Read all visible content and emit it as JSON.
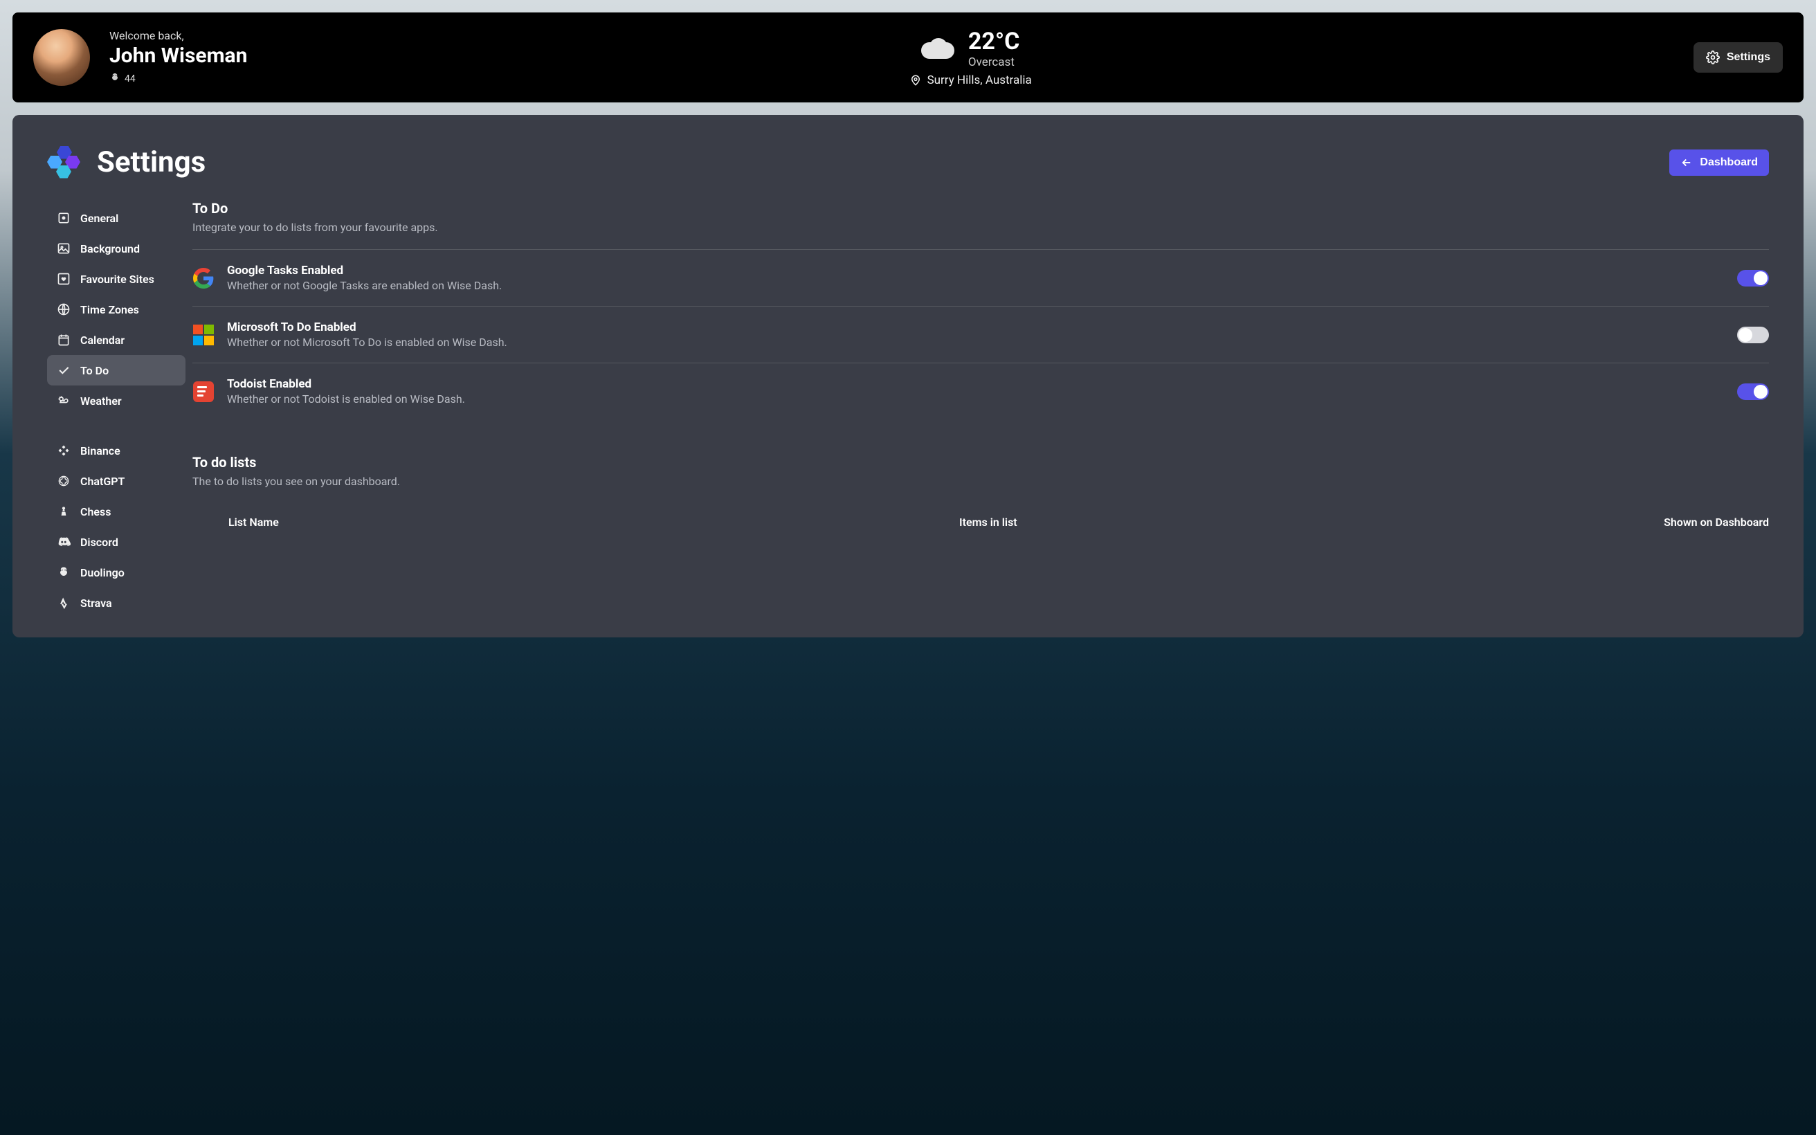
{
  "header": {
    "welcome": "Welcome back,",
    "username": "John Wiseman",
    "points": "44",
    "weather": {
      "temp": "22°C",
      "condition": "Overcast",
      "location": "Surry Hills, Australia"
    },
    "settings_button": "Settings"
  },
  "panel": {
    "title": "Settings",
    "dashboard_button": "Dashboard"
  },
  "sidebar": {
    "group1": [
      {
        "id": "general",
        "label": "General"
      },
      {
        "id": "background",
        "label": "Background"
      },
      {
        "id": "favourite-sites",
        "label": "Favourite Sites"
      },
      {
        "id": "time-zones",
        "label": "Time Zones"
      },
      {
        "id": "calendar",
        "label": "Calendar"
      },
      {
        "id": "to-do",
        "label": "To Do"
      },
      {
        "id": "weather",
        "label": "Weather"
      }
    ],
    "group2": [
      {
        "id": "binance",
        "label": "Binance"
      },
      {
        "id": "chatgpt",
        "label": "ChatGPT"
      },
      {
        "id": "chess",
        "label": "Chess"
      },
      {
        "id": "discord",
        "label": "Discord"
      },
      {
        "id": "duolingo",
        "label": "Duolingo"
      },
      {
        "id": "strava",
        "label": "Strava"
      }
    ],
    "active": "to-do"
  },
  "todo_section": {
    "title": "To Do",
    "desc": "Integrate your to do lists from your favourite apps.",
    "settings": [
      {
        "app": "google",
        "title": "Google Tasks Enabled",
        "desc": "Whether or not Google Tasks are enabled on Wise Dash.",
        "enabled": true
      },
      {
        "app": "microsoft",
        "title": "Microsoft To Do Enabled",
        "desc": "Whether or not Microsoft To Do is enabled on Wise Dash.",
        "enabled": false
      },
      {
        "app": "todoist",
        "title": "Todoist Enabled",
        "desc": "Whether or not Todoist is enabled on Wise Dash.",
        "enabled": true
      }
    ]
  },
  "lists_section": {
    "title": "To do lists",
    "desc": "The to do lists you see on your dashboard.",
    "columns": {
      "name": "List Name",
      "items": "Items in list",
      "shown": "Shown on Dashboard"
    }
  }
}
